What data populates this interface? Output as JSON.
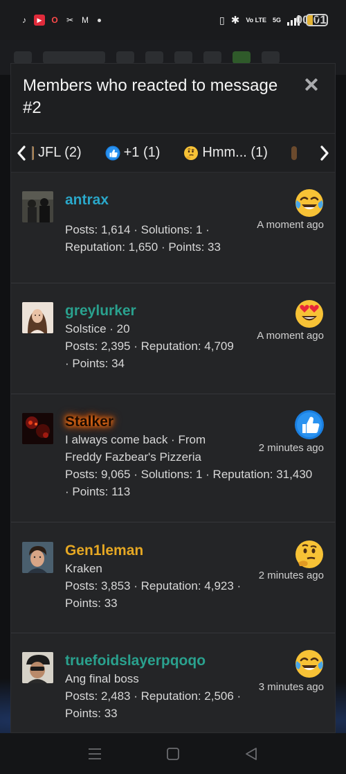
{
  "status_bar": {
    "time": "00:01",
    "battery_level": "7",
    "network": "5G",
    "volte": "Vo LTE",
    "notification_icons": [
      "tiktok-icon",
      "youtube-music-icon",
      "opera-icon",
      "capcut-icon",
      "gmail-icon"
    ]
  },
  "modal": {
    "title": "Members who reacted to message #2",
    "tabs": [
      {
        "label": "JFL (2)",
        "icon": "partial-reaction-icon"
      },
      {
        "label": "+1 (1)",
        "icon": "thumbs-up-emoji"
      },
      {
        "label": "Hmm... (1)",
        "icon": "thinking-face-emoji"
      }
    ],
    "members": [
      {
        "username": "antrax",
        "name_color": "#2aa7c9",
        "lines": [
          "Posts: 1,614 · Solutions: 1 ·",
          "Reputation: 1,650 · Points: 33"
        ],
        "time": "A moment ago",
        "reaction": "tears-of-joy-emoji"
      },
      {
        "username": "greylurker",
        "name_color": "#2aa18e",
        "lines": [
          "Solstice · 20",
          "Posts: 2,395 · Reputation: 4,709",
          "· Points: 34"
        ],
        "time": "A moment ago",
        "reaction": "heart-eyes-emoji"
      },
      {
        "username": "Stalker",
        "name_color": "#ff6a00",
        "lines": [
          "I always come back · From",
          "Freddy Fazbear's Pizzeria",
          "Posts: 9,065 · Solutions: 1 · Reputation: 31,430",
          "· Points: 113"
        ],
        "time": "2 minutes ago",
        "reaction": "thumbs-up-emoji"
      },
      {
        "username": "Gen1leman",
        "name_color": "#e6a823",
        "lines": [
          "Kraken",
          "Posts: 3,853 · Reputation: 4,923 ·",
          "Points: 33"
        ],
        "time": "2 minutes ago",
        "reaction": "thinking-face-emoji"
      },
      {
        "username": "truefoidslayerpqoqo",
        "name_color": "#2aa18e",
        "lines": [
          "Ang final boss",
          "Posts: 2,483 · Reputation: 2,506 ·",
          "Points: 33"
        ],
        "time": "3 minutes ago",
        "reaction": "tears-of-joy-emoji"
      }
    ]
  },
  "nav": {
    "buttons": [
      "recents-icon",
      "home-icon",
      "back-icon"
    ]
  }
}
